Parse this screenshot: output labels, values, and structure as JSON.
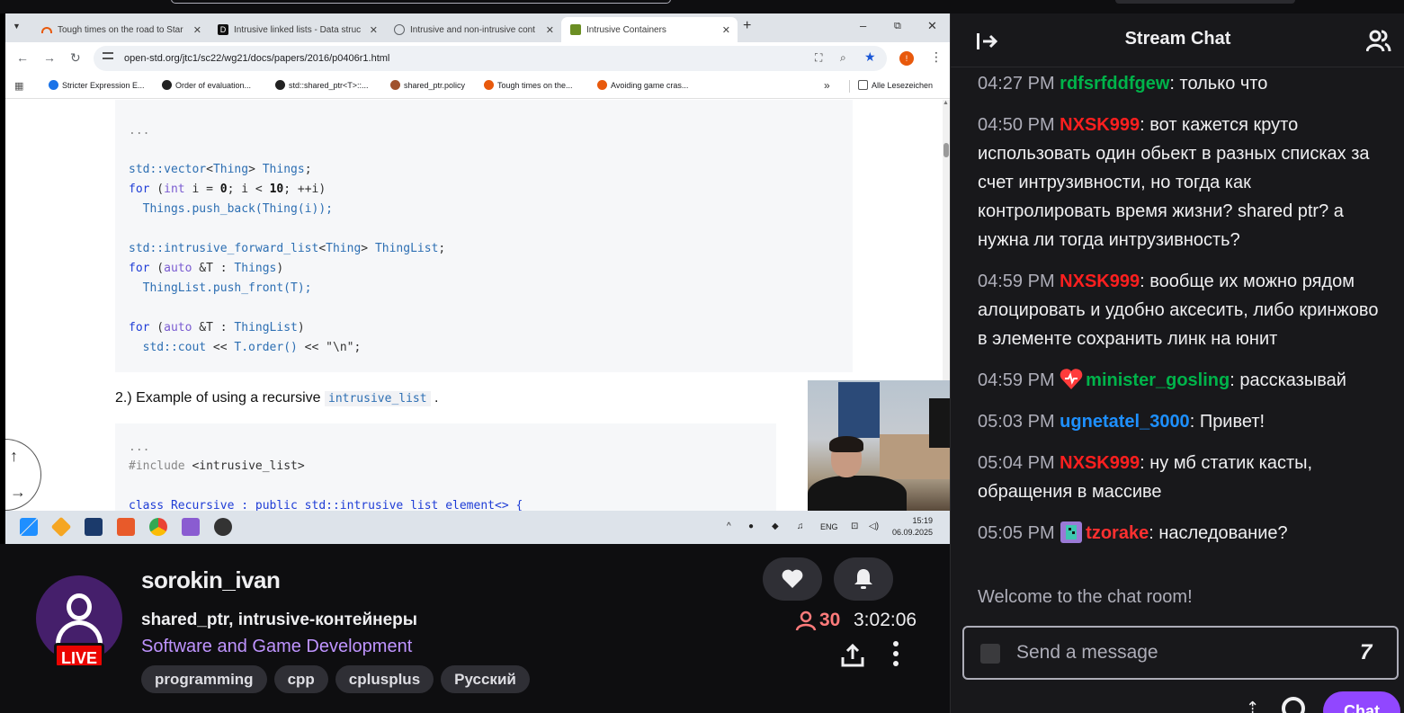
{
  "browser": {
    "tabs": [
      {
        "label": "Tough times on the road to Star",
        "fav_color": "#e8590c"
      },
      {
        "label": "Intrusive linked lists - Data struc",
        "fav_color": "#111111"
      },
      {
        "label": "Intrusive and non-intrusive cont",
        "fav_color": "#5f6368"
      },
      {
        "label": "Intrusive Containers",
        "fav_color": "#6b8e23"
      }
    ],
    "window_controls": {
      "minimize": "–",
      "restore": "⧉",
      "close": "✕"
    },
    "url": "open-std.org/jtc1/sc22/wg21/docs/papers/2016/p0406r1.html",
    "profile_initial": "!",
    "bookmarks": [
      {
        "label": "Stricter Expression E...",
        "color": "#1a73e8"
      },
      {
        "label": "Order of evaluation...",
        "color": "#222222"
      },
      {
        "label": "std::shared_ptr<T>::...",
        "color": "#222222"
      },
      {
        "label": "shared_ptr.policy",
        "color": "#a0522d"
      },
      {
        "label": "Tough times on the...",
        "color": "#e8590c"
      },
      {
        "label": "Avoiding game cras...",
        "color": "#e8590c"
      }
    ],
    "bookmarks_all": "Alle Lesezeichen"
  },
  "document": {
    "code1": {
      "ellipsis": "...",
      "l1_a": "std::",
      "l1_b": "vector",
      "l1_c": "<",
      "l1_d": "Thing",
      "l1_e": "> ",
      "l1_f": "Things",
      "l1_g": ";",
      "l2_a": "for",
      "l2_b": " (",
      "l2_c": "int",
      "l2_d": " i = ",
      "l2_e": "0",
      "l2_f": "; i < ",
      "l2_g": "10",
      "l2_h": "; ++i)",
      "l3": "  Things.push_back(Thing(i));",
      "l4_a": "std::",
      "l4_b": "intrusive_forward_list",
      "l4_c": "<",
      "l4_d": "Thing",
      "l4_e": "> ",
      "l4_f": "ThingList",
      "l4_g": ";",
      "l5_a": "for",
      "l5_b": " (",
      "l5_c": "auto",
      "l5_d": " &T : ",
      "l5_e": "Things",
      "l5_f": ")",
      "l6": "  ThingList.push_front(T);",
      "l7_a": "for",
      "l7_b": " (",
      "l7_c": "auto",
      "l7_d": " &T : ",
      "l7_e": "ThingList",
      "l7_f": ")",
      "l8_a": "  std::cout",
      "l8_b": " << ",
      "l8_c": "T.order()",
      "l8_d": " << ",
      "l8_e": "\"\\n\"",
      "l8_f": ";"
    },
    "heading_text": "2.) Example of using a recursive ",
    "heading_code": "intrusive_list",
    "heading_end": " .",
    "code2": {
      "ellipsis": "...",
      "include_a": "#include",
      "include_b": " <intrusive_list>",
      "class_line": "class Recursive : public std::intrusive_list_element<> {"
    }
  },
  "taskbar": {
    "clock_time": "15:19",
    "clock_date": "06.09.2025",
    "lang": "ENG"
  },
  "stream": {
    "channel": "sorokin_ivan",
    "live_badge": "LIVE",
    "title": "shared_ptr, intrusive-контейнеры",
    "category": "Software and Game Development",
    "tags": [
      "programming",
      "cpp",
      "cplusplus",
      "Русский"
    ],
    "viewers": "30",
    "uptime": "3:02:06"
  },
  "chat": {
    "title": "Stream Chat",
    "messages": [
      {
        "time": "04:27 PM",
        "user": "rdfsrfddfgew",
        "color": "#00b34a",
        "text": "только что",
        "badge": ""
      },
      {
        "time": "04:50 PM",
        "user": "NXSK999",
        "color": "#ff1f1f",
        "text": "вот кажется круто использовать один обьект в разных списках за счет интрузивности, но тогда как контролировать время жизни? shared ptr? а нужна ли тогда интрузивность?",
        "badge": ""
      },
      {
        "time": "04:59 PM",
        "user": "NXSK999",
        "color": "#ff1f1f",
        "text": "вообще их можно рядом алоцировать и удобно аксесить, либо кринжово в элементе сохранить линк на юнит",
        "badge": ""
      },
      {
        "time": "04:59 PM",
        "user": "minister_gosling",
        "color": "#00b34a",
        "text": "рассказывай",
        "badge": "heart"
      },
      {
        "time": "05:03 PM",
        "user": "ugnetatel_3000",
        "color": "#1e90ff",
        "text": "Привет!",
        "badge": ""
      },
      {
        "time": "05:04 PM",
        "user": "NXSK999",
        "color": "#ff1f1f",
        "text": "ну мб статик касты, обращения в массиве",
        "badge": ""
      },
      {
        "time": "05:05 PM",
        "user": "tzorake",
        "color": "#ff3030",
        "text": "наследование?",
        "badge": "pixel"
      }
    ],
    "welcome": "Welcome to the chat room!",
    "input_placeholder": "Send a message",
    "chat_button": "Chat"
  }
}
